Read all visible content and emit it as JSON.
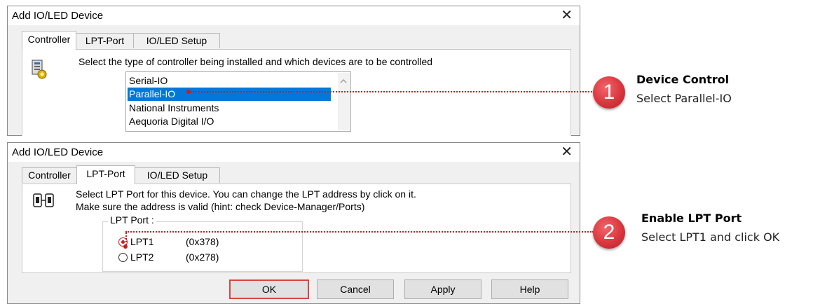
{
  "dialog1": {
    "title": "Add IO/LED Device",
    "close": "✕",
    "tabs": [
      "Controller",
      "LPT-Port",
      "IO/LED Setup"
    ],
    "active_tab": "Controller",
    "instruction": "Select the type of controller being installed and which devices are to be controlled",
    "list_items": [
      "Serial-IO",
      "Parallel-IO",
      "National Instruments",
      "Aequoria Digital I/O"
    ],
    "selected_item": "Parallel-IO",
    "icon": "controller-device-icon"
  },
  "dialog2": {
    "title": "Add IO/LED Device",
    "close": "✕",
    "tabs": [
      "Controller",
      "LPT-Port",
      "IO/LED Setup"
    ],
    "active_tab": "LPT-Port",
    "instruction_line1": "Select LPT Port for this device. You can change the LPT address by click on it.",
    "instruction_line2": "Make sure the address is valid (hint: check Device-Manager/Ports)",
    "group_label": "LPT Port :",
    "ports": [
      {
        "name": "LPT1",
        "address": "(0x378)",
        "selected": true
      },
      {
        "name": "LPT2",
        "address": "(0x278)",
        "selected": false
      }
    ],
    "buttons": {
      "ok": "OK",
      "cancel": "Cancel",
      "apply": "Apply",
      "help": "Help"
    },
    "icon": "port-connector-icon"
  },
  "callouts": [
    {
      "number": "1",
      "title": "Device Control",
      "text": "Select Parallel-IO"
    },
    {
      "number": "2",
      "title": "Enable LPT Port",
      "text": "Select LPT1 and click OK"
    }
  ],
  "colors": {
    "accent": "#0078d7",
    "highlight": "#c61d23",
    "badge": "#d9363d"
  }
}
